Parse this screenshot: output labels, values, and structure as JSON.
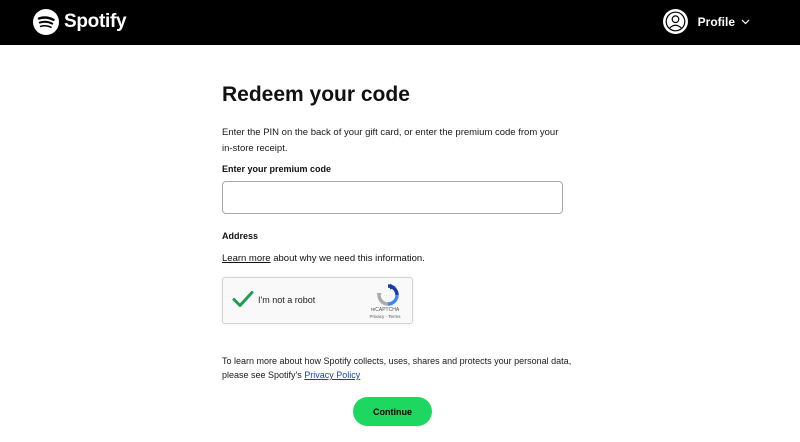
{
  "header": {
    "brand": "Spotify",
    "logo_icon": "spotify-logo-icon",
    "profile_label": "Profile",
    "avatar_icon": "user-icon",
    "chevron_icon": "chevron-down-icon",
    "background": "#000000"
  },
  "form": {
    "title": "Redeem your code",
    "intro": "Enter the PIN on the back of your gift card, or enter the premium code from your in-store receipt.",
    "code_label": "Enter your premium code",
    "code_value": "",
    "address_label": "Address",
    "learn_more_link": "Learn more",
    "learn_more_rest": " about why we need this information.",
    "privacy_text": "To learn more about how Spotify collects, uses, shares and protects your personal data, please see Spotify's ",
    "privacy_link": "Privacy Policy",
    "continue_label": "Continue",
    "accent": "#1ed760"
  },
  "recaptcha": {
    "label": "I'm not a robot",
    "checked": true,
    "brand": "reCAPTCHA",
    "privacy": "Privacy",
    "separator": " - ",
    "terms": "Terms",
    "check_color": "#1f9d55"
  }
}
